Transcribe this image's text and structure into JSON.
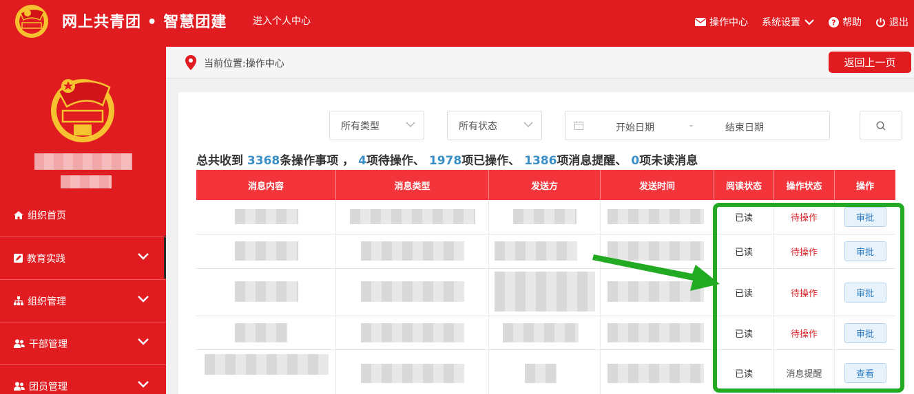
{
  "header": {
    "brand": "网上共青团 • 智慧团建",
    "personal_center": "进入个人中心",
    "nav": [
      {
        "label": "操作中心",
        "icon": "envelope-icon"
      },
      {
        "label": "系统设置",
        "icon": "chevron-down-icon"
      },
      {
        "label": "帮助",
        "icon": "help-icon"
      },
      {
        "label": "退出",
        "icon": "power-icon"
      }
    ]
  },
  "sidebar": {
    "items": [
      {
        "label": "组织首页",
        "icon": "home-icon"
      },
      {
        "label": "教育实践",
        "icon": "edit-icon"
      },
      {
        "label": "组织管理",
        "icon": "sitemap-icon"
      },
      {
        "label": "干部管理",
        "icon": "users-icon"
      },
      {
        "label": "团员管理",
        "icon": "users-icon"
      }
    ]
  },
  "breadcrumb": {
    "text": "当前位置:操作中心",
    "back_label": "返回上一页"
  },
  "filters": {
    "type": "所有类型",
    "status": "所有状态",
    "start_date": "开始日期",
    "separator": "-",
    "end_date": "结束日期"
  },
  "summary": {
    "prefix": "总共收到 ",
    "total": "3368",
    "t1": "条操作事项 ， ",
    "pending": "4",
    "t2": "项待操作、 ",
    "done": "1978",
    "t3": "项已操作、 ",
    "notify": "1386",
    "t4": "项消息提醒、 ",
    "unread": "0",
    "t5": "项未读消息"
  },
  "table": {
    "headers": [
      "消息内容",
      "消息类型",
      "发送方",
      "发送时间",
      "阅读状态",
      "操作状态",
      "操作"
    ],
    "rows": [
      {
        "read": "已读",
        "status": "待操作",
        "action": "审批"
      },
      {
        "read": "已读",
        "status": "待操作",
        "action": "审批"
      },
      {
        "read": "已读",
        "status": "待操作",
        "action": "审批"
      },
      {
        "read": "已读",
        "status": "待操作",
        "action": "审批"
      },
      {
        "read": "已读",
        "status": "消息提醒",
        "action": "查看"
      }
    ]
  },
  "colors": {
    "brand_red": "#e11c21",
    "header_red": "#f3353b",
    "number_blue": "#3a8ec6",
    "highlight_green": "#22aa22"
  }
}
